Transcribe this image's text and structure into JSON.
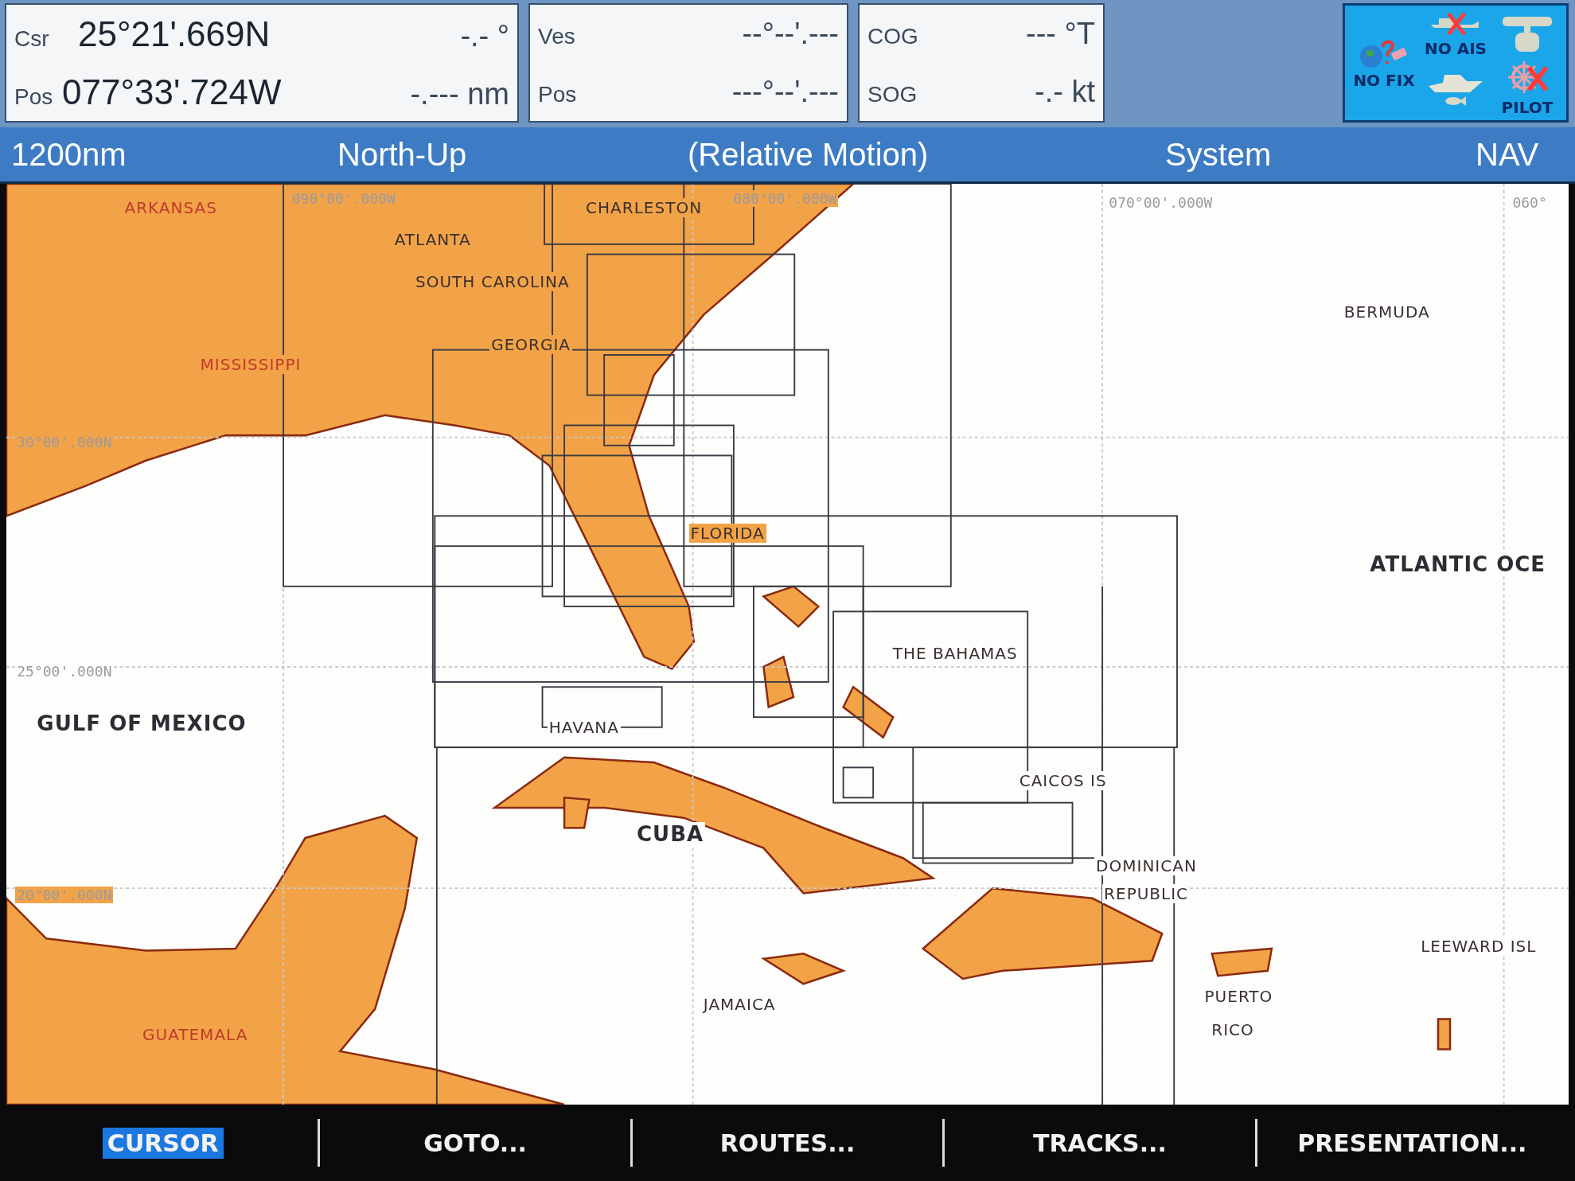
{
  "cursor_panel": {
    "rows": [
      {
        "label": "Csr",
        "value": "25°21'.669N",
        "reading": "-.- °"
      },
      {
        "label": "Pos",
        "value": "077°33'.724W",
        "reading": "-.--- nm"
      }
    ]
  },
  "vessel_panel": {
    "rows": [
      {
        "label": "Ves",
        "value": "--°--'.---"
      },
      {
        "label": "Pos",
        "value": "---°--'.---"
      }
    ]
  },
  "motion_panel": {
    "rows": [
      {
        "label": "COG",
        "value": "--- °T"
      },
      {
        "label": "SOG",
        "value": "-.- kt"
      }
    ]
  },
  "status_icons": [
    {
      "label": "NO FIX"
    },
    {
      "label": "NO AIS"
    },
    {
      "label": "PILOT"
    }
  ],
  "status_bar": {
    "range": "1200nm",
    "orientation": "North-Up",
    "motion": "(Relative Motion)",
    "reference": "System",
    "mode": "NAV"
  },
  "chart": {
    "grid_labels": [
      "090°00'.000W",
      "080°00'.000W",
      "070°00'.000W",
      "060°",
      "30°00'.000N",
      "25°00'.000N",
      "20°00'.000N"
    ],
    "place_labels": [
      {
        "text": "ARKANSAS",
        "kind": "region"
      },
      {
        "text": "ATLANTA",
        "kind": "place"
      },
      {
        "text": "CHARLESTON",
        "kind": "place"
      },
      {
        "text": "SOUTH CAROLINA",
        "kind": "place"
      },
      {
        "text": "GEORGIA",
        "kind": "place"
      },
      {
        "text": "MISSISSIPPI",
        "kind": "region"
      },
      {
        "text": "BERMUDA",
        "kind": "place"
      },
      {
        "text": "FLORIDA",
        "kind": "place"
      },
      {
        "text": "ATLANTIC OCE",
        "kind": "ocean"
      },
      {
        "text": "THE BAHAMAS",
        "kind": "place"
      },
      {
        "text": "GULF OF MEXICO",
        "kind": "ocean"
      },
      {
        "text": "HAVANA",
        "kind": "place"
      },
      {
        "text": "CAICOS IS",
        "kind": "place"
      },
      {
        "text": "CUBA",
        "kind": "ocean"
      },
      {
        "text": "DOMINICAN",
        "kind": "place"
      },
      {
        "text": "REPUBLIC",
        "kind": "place"
      },
      {
        "text": "LEEWARD ISL",
        "kind": "place"
      },
      {
        "text": "JAMAICA",
        "kind": "place"
      },
      {
        "text": "PUERTO",
        "kind": "place"
      },
      {
        "text": "RICO",
        "kind": "place"
      },
      {
        "text": "GUATEMALA",
        "kind": "region"
      }
    ]
  },
  "softkeys": [
    {
      "label": "CURSOR",
      "selected": true
    },
    {
      "label": "GOTO...",
      "selected": false
    },
    {
      "label": "ROUTES...",
      "selected": false
    },
    {
      "label": "TRACKS...",
      "selected": false
    },
    {
      "label": "PRESENTATION...",
      "selected": false
    }
  ]
}
